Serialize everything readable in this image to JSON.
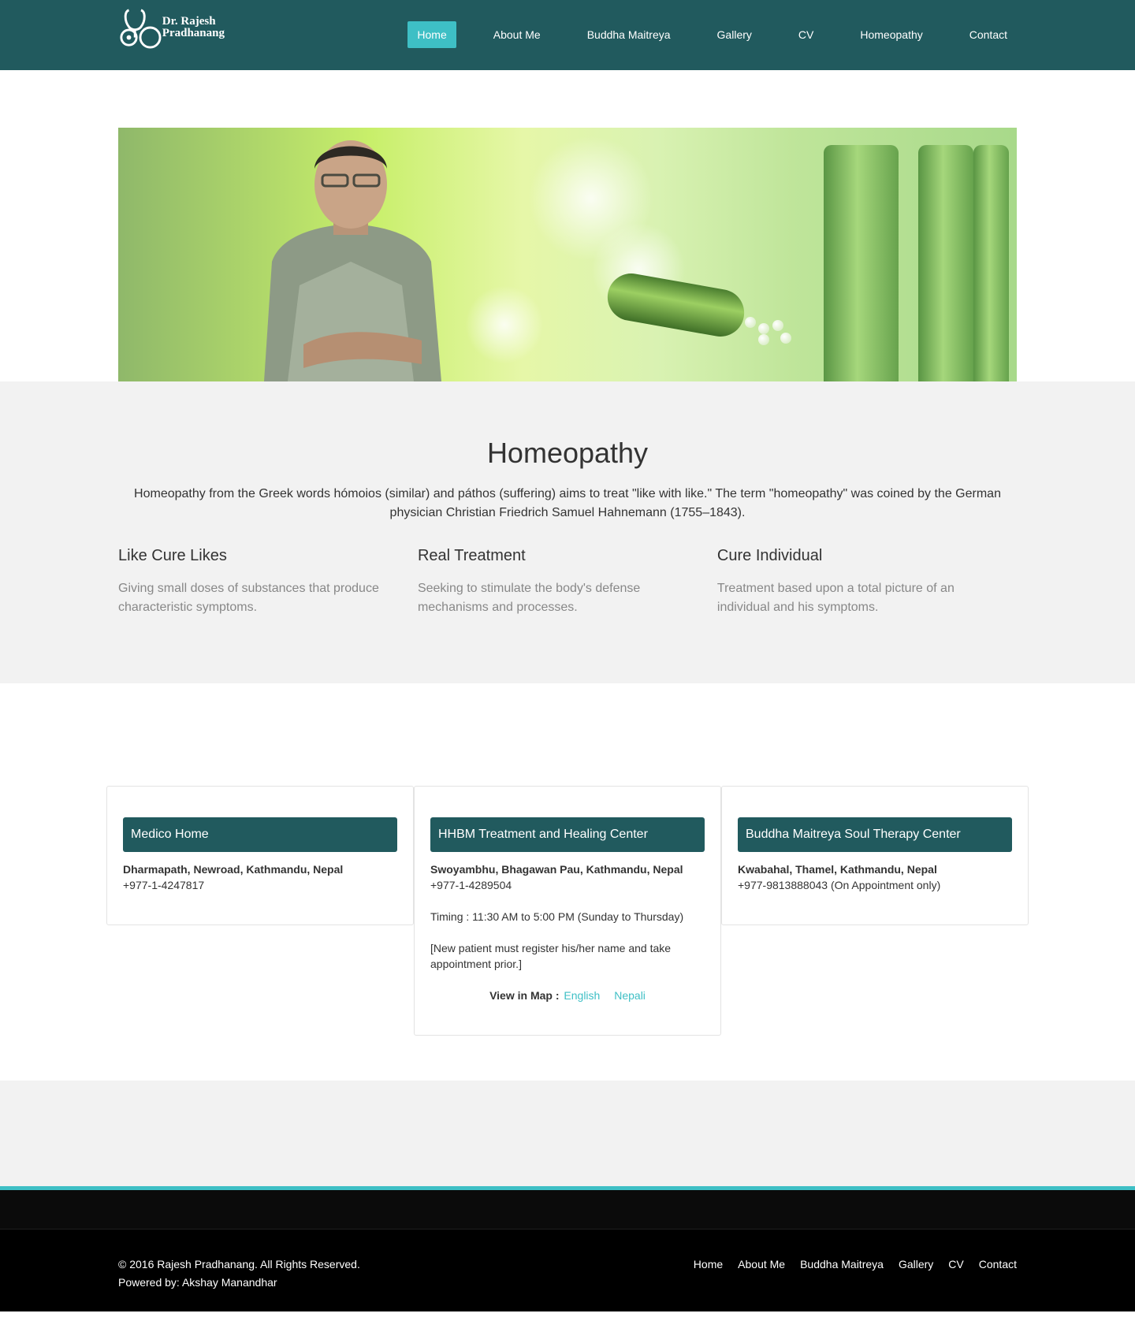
{
  "header": {
    "logo": {
      "line1": "Dr. Rajesh",
      "line2": "Pradhanang",
      "icon": "stethoscope-icon"
    },
    "nav": [
      {
        "label": "Home",
        "active": true
      },
      {
        "label": "About Me"
      },
      {
        "label": "Buddha Maitreya"
      },
      {
        "label": "Gallery"
      },
      {
        "label": "CV"
      },
      {
        "label": "Homeopathy"
      },
      {
        "label": "Contact"
      }
    ]
  },
  "intro": {
    "title": "Homeopathy",
    "lead": "Homeopathy from the Greek words hómoios (similar) and páthos (suffering) aims to treat \"like with like.\" The term \"homeopathy\" was coined by the German physician Christian Friedrich Samuel Hahnemann (1755–1843).",
    "features": [
      {
        "title": "Like Cure Likes",
        "text": "Giving small doses of substances that produce characteristic symptoms."
      },
      {
        "title": "Real Treatment",
        "text": "Seeking to stimulate the body's defense mechanisms and processes."
      },
      {
        "title": "Cure Individual",
        "text": "Treatment based upon a total picture of an individual and his symptoms."
      }
    ]
  },
  "locations": [
    {
      "title": "Medico Home",
      "address": "Dharmapath, Newroad, Kathmandu, Nepal",
      "phone": "+977-1-4247817"
    },
    {
      "title": "HHBM Treatment and Healing Center",
      "address": "Swoyambhu, Bhagawan Pau, Kathmandu, Nepal",
      "phone": "+977-1-4289504",
      "timing": "Timing : 11:30 AM to 5:00 PM (Sunday to Thursday)",
      "note": "[New patient must register his/her name and take appointment prior.]",
      "map_label": "View in Map :",
      "map_links": [
        "English",
        "Nepali"
      ]
    },
    {
      "title": "Buddha Maitreya Soul Therapy Center",
      "address": "Kwabahal, Thamel, Kathmandu, Nepal",
      "phone": "+977-9813888043 (On Appointment only)"
    }
  ],
  "footer": {
    "copyright": "© 2016 Rajesh Pradhanang. All Rights Reserved.",
    "powered": "Powered by: Akshay Manandhar",
    "nav": [
      "Home",
      "About Me",
      "Buddha Maitreya",
      "Gallery",
      "CV",
      "Contact"
    ]
  },
  "colors": {
    "header_bg": "#215a5e",
    "accent": "#3ebfc5",
    "section_grey": "#f2f2f2",
    "footer_bg": "#000000"
  }
}
